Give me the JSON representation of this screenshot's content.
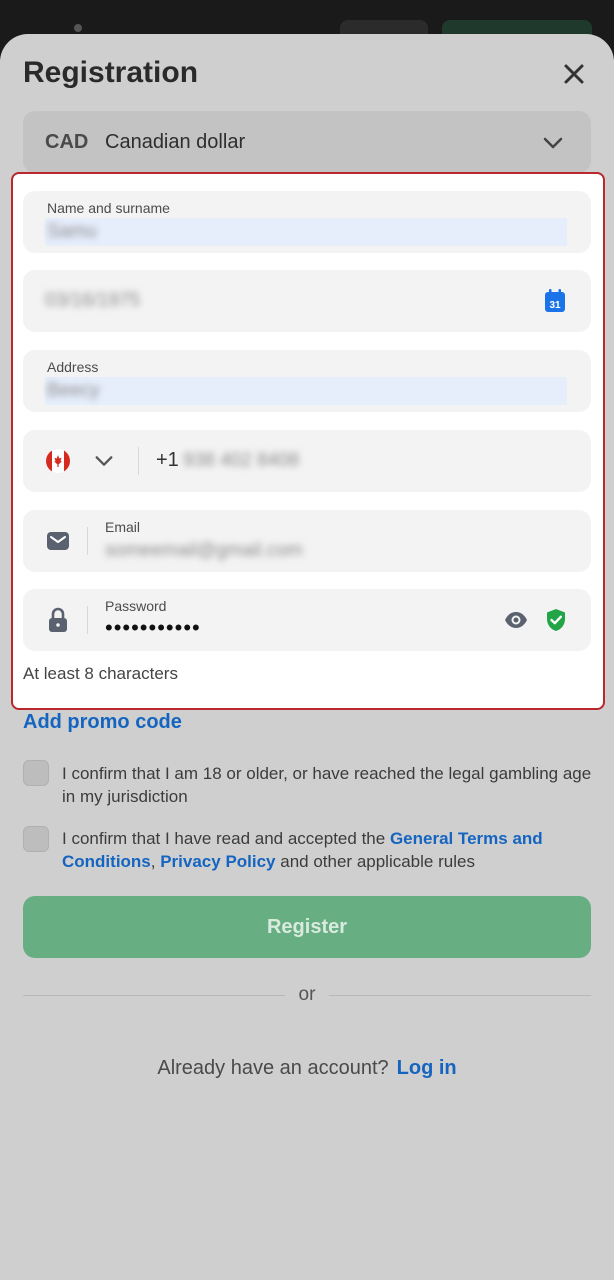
{
  "header": {
    "title": "Registration"
  },
  "currency": {
    "code": "CAD",
    "name": "Canadian dollar"
  },
  "form": {
    "name": {
      "label": "Name and surname",
      "value": "Samu"
    },
    "dob": {
      "value": "03/16/1975",
      "calendar_day": "31"
    },
    "address": {
      "label": "Address",
      "value": "Beecy"
    },
    "phone": {
      "prefix": "+1",
      "value": "938 402 8408"
    },
    "email": {
      "label": "Email",
      "value": "someemail@gmail.com"
    },
    "password": {
      "label": "Password",
      "value": "•••••••••••"
    },
    "password_hint": "At least 8 characters"
  },
  "promo_link": "Add promo code",
  "consents": {
    "age": "I confirm that I am 18 or older, or have reached the legal gambling age in my jurisdiction",
    "terms_prefix": "I confirm that I have read and accepted the ",
    "terms_link": "General Terms and Conditions",
    "terms_sep": ", ",
    "privacy_link": "Privacy Policy",
    "terms_suffix": " and other applicable rules"
  },
  "register_button": "Register",
  "or_text": "or",
  "login_prompt": {
    "text": "Already have an account?",
    "link": "Log in"
  },
  "colors": {
    "accent": "#1565c0",
    "register_bg": "#68ae83",
    "highlight_border": "#b9282c",
    "shield": "#22a447",
    "calendar": "#1a73e8",
    "flag_red": "#d52b1e"
  }
}
